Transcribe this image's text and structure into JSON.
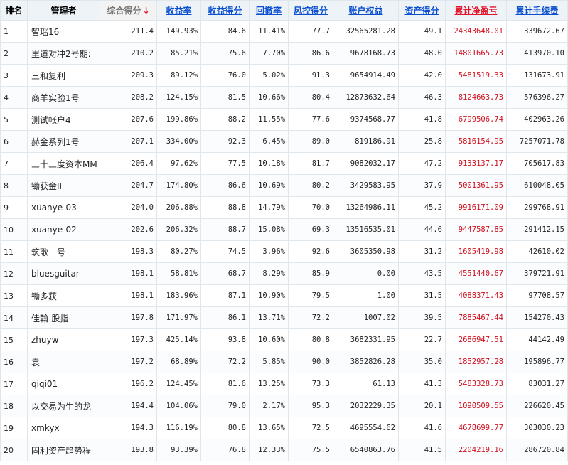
{
  "headers": {
    "rank": "排名",
    "manager": "管理者",
    "total_score": "综合得分",
    "return_rate": "收益率",
    "return_score": "收益得分",
    "drawdown": "回撤率",
    "risk_score": "风控得分",
    "equity": "账户权益",
    "asset_score": "资产得分",
    "cum_pnl": "累计净盈亏",
    "cum_fee": "累计手续费"
  },
  "sort_arrow": "↓",
  "colors": {
    "link_blue": "#0a4fd0",
    "loss_red": "#d1101f",
    "header_bg": "#eef3f8"
  },
  "rows": [
    {
      "rank": "1",
      "manager": "智瑶16",
      "total_score": "211.4",
      "return_rate": "149.93%",
      "return_score": "84.6",
      "drawdown": "11.41%",
      "risk_score": "77.7",
      "equity": "32565281.28",
      "asset_score": "49.1",
      "cum_pnl": "24343648.01",
      "cum_fee": "339672.67"
    },
    {
      "rank": "2",
      "manager": "里道对冲2号期:",
      "total_score": "210.2",
      "return_rate": "85.21%",
      "return_score": "75.6",
      "drawdown": "7.70%",
      "risk_score": "86.6",
      "equity": "9678168.73",
      "asset_score": "48.0",
      "cum_pnl": "14801665.73",
      "cum_fee": "413970.10"
    },
    {
      "rank": "3",
      "manager": "三和复利",
      "total_score": "209.3",
      "return_rate": "89.12%",
      "return_score": "76.0",
      "drawdown": "5.02%",
      "risk_score": "91.3",
      "equity": "9654914.49",
      "asset_score": "42.0",
      "cum_pnl": "5481519.33",
      "cum_fee": "131673.91"
    },
    {
      "rank": "4",
      "manager": "商羊实验1号",
      "total_score": "208.2",
      "return_rate": "124.15%",
      "return_score": "81.5",
      "drawdown": "10.66%",
      "risk_score": "80.4",
      "equity": "12873632.64",
      "asset_score": "46.3",
      "cum_pnl": "8124663.73",
      "cum_fee": "576396.27"
    },
    {
      "rank": "5",
      "manager": "测试帐户4",
      "total_score": "207.6",
      "return_rate": "199.86%",
      "return_score": "88.2",
      "drawdown": "11.55%",
      "risk_score": "77.6",
      "equity": "9374568.77",
      "asset_score": "41.8",
      "cum_pnl": "6799506.74",
      "cum_fee": "402963.26"
    },
    {
      "rank": "6",
      "manager": "赫金系列1号",
      "total_score": "207.1",
      "return_rate": "334.00%",
      "return_score": "92.3",
      "drawdown": "6.45%",
      "risk_score": "89.0",
      "equity": "819186.91",
      "asset_score": "25.8",
      "cum_pnl": "5816154.95",
      "cum_fee": "7257071.78"
    },
    {
      "rank": "7",
      "manager": "三十三度资本MM",
      "total_score": "206.4",
      "return_rate": "97.62%",
      "return_score": "77.5",
      "drawdown": "10.18%",
      "risk_score": "81.7",
      "equity": "9082032.17",
      "asset_score": "47.2",
      "cum_pnl": "9133137.17",
      "cum_fee": "705617.83"
    },
    {
      "rank": "8",
      "manager": "锄获金II",
      "total_score": "204.7",
      "return_rate": "174.80%",
      "return_score": "86.6",
      "drawdown": "10.69%",
      "risk_score": "80.2",
      "equity": "3429583.95",
      "asset_score": "37.9",
      "cum_pnl": "5001361.95",
      "cum_fee": "610048.05"
    },
    {
      "rank": "9",
      "manager": "xuanye-03",
      "total_score": "204.0",
      "return_rate": "206.88%",
      "return_score": "88.8",
      "drawdown": "14.79%",
      "risk_score": "70.0",
      "equity": "13264986.11",
      "asset_score": "45.2",
      "cum_pnl": "9916171.09",
      "cum_fee": "299768.91"
    },
    {
      "rank": "10",
      "manager": "xuanye-02",
      "total_score": "202.6",
      "return_rate": "206.32%",
      "return_score": "88.7",
      "drawdown": "15.08%",
      "risk_score": "69.3",
      "equity": "13516535.01",
      "asset_score": "44.6",
      "cum_pnl": "9447587.85",
      "cum_fee": "291412.15"
    },
    {
      "rank": "11",
      "manager": "筑歌一号",
      "total_score": "198.3",
      "return_rate": "80.27%",
      "return_score": "74.5",
      "drawdown": "3.96%",
      "risk_score": "92.6",
      "equity": "3605350.98",
      "asset_score": "31.2",
      "cum_pnl": "1605419.98",
      "cum_fee": "42610.02"
    },
    {
      "rank": "12",
      "manager": "bluesguitar",
      "total_score": "198.1",
      "return_rate": "58.81%",
      "return_score": "68.7",
      "drawdown": "8.29%",
      "risk_score": "85.9",
      "equity": "0.00",
      "asset_score": "43.5",
      "cum_pnl": "4551440.67",
      "cum_fee": "379721.91"
    },
    {
      "rank": "13",
      "manager": "锄多获",
      "total_score": "198.1",
      "return_rate": "183.96%",
      "return_score": "87.1",
      "drawdown": "10.90%",
      "risk_score": "79.5",
      "equity": "1.00",
      "asset_score": "31.5",
      "cum_pnl": "4088371.43",
      "cum_fee": "97708.57"
    },
    {
      "rank": "14",
      "manager": "佳翰-股指",
      "total_score": "197.8",
      "return_rate": "171.97%",
      "return_score": "86.1",
      "drawdown": "13.71%",
      "risk_score": "72.2",
      "equity": "1007.02",
      "asset_score": "39.5",
      "cum_pnl": "7885467.44",
      "cum_fee": "154270.43"
    },
    {
      "rank": "15",
      "manager": "zhuyw",
      "total_score": "197.3",
      "return_rate": "425.14%",
      "return_score": "93.8",
      "drawdown": "10.60%",
      "risk_score": "80.8",
      "equity": "3682331.95",
      "asset_score": "22.7",
      "cum_pnl": "2686947.51",
      "cum_fee": "44142.49"
    },
    {
      "rank": "16",
      "manager": "袁",
      "total_score": "197.2",
      "return_rate": "68.89%",
      "return_score": "72.2",
      "drawdown": "5.85%",
      "risk_score": "90.0",
      "equity": "3852826.28",
      "asset_score": "35.0",
      "cum_pnl": "1852957.28",
      "cum_fee": "195896.77"
    },
    {
      "rank": "17",
      "manager": "qiqi01",
      "total_score": "196.2",
      "return_rate": "124.45%",
      "return_score": "81.6",
      "drawdown": "13.25%",
      "risk_score": "73.3",
      "equity": "61.13",
      "asset_score": "41.3",
      "cum_pnl": "5483328.73",
      "cum_fee": "83031.27"
    },
    {
      "rank": "18",
      "manager": "以交易为生的龙",
      "total_score": "194.4",
      "return_rate": "104.06%",
      "return_score": "79.0",
      "drawdown": "2.17%",
      "risk_score": "95.3",
      "equity": "2032229.35",
      "asset_score": "20.1",
      "cum_pnl": "1090509.55",
      "cum_fee": "226620.45"
    },
    {
      "rank": "19",
      "manager": "xmkyx",
      "total_score": "194.3",
      "return_rate": "116.19%",
      "return_score": "80.8",
      "drawdown": "13.65%",
      "risk_score": "72.5",
      "equity": "4695554.62",
      "asset_score": "41.6",
      "cum_pnl": "4678699.77",
      "cum_fee": "303030.23"
    },
    {
      "rank": "20",
      "manager": "固利资产趋势程",
      "total_score": "193.8",
      "return_rate": "93.39%",
      "return_score": "76.8",
      "drawdown": "12.33%",
      "risk_score": "75.5",
      "equity": "6540863.76",
      "asset_score": "41.5",
      "cum_pnl": "2204219.16",
      "cum_fee": "286720.84"
    }
  ]
}
